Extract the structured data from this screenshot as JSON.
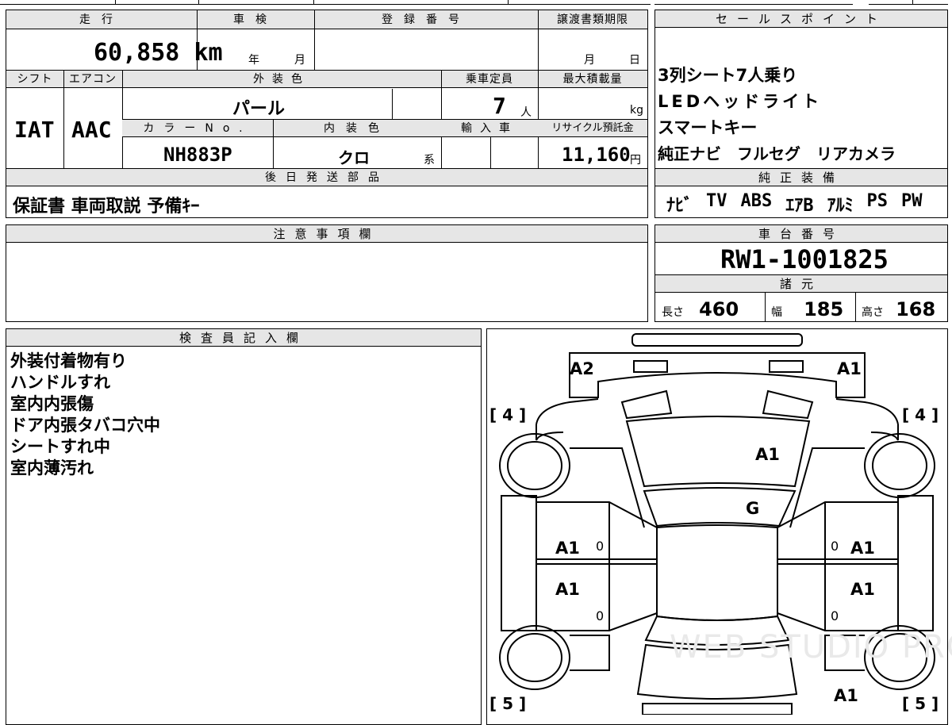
{
  "top": {
    "mileage_label": "走行",
    "mileage_value": "60,858",
    "mileage_unit": "km",
    "inspection_label": "車検",
    "inspection_year": "年",
    "inspection_month": "月",
    "registration_label": "登録番号",
    "transfer_label": "譲渡書類期限",
    "transfer_month": "月",
    "transfer_day": "日",
    "shift_label": "シフト",
    "shift_value": "IAT",
    "ac_label": "エアコン",
    "ac_value": "AAC",
    "exterior_label": "外装色",
    "exterior_value": "パール",
    "capacity_label": "乗車定員",
    "capacity_value": "7",
    "capacity_unit": "人",
    "maxload_label": "最大積載量",
    "maxload_unit": "kg",
    "colorno_label": "カラーNo.",
    "colorno_value": "NH883P",
    "interior_label": "内装色",
    "interior_value": "クロ",
    "interior_unit": "系",
    "import_label": "輸入車",
    "recycle_label": "リサイクル預託金",
    "recycle_value": "11,160",
    "recycle_unit": "円",
    "later_label": "後日発送部品",
    "later_value": "保証書 車両取説 予備ｷｰ"
  },
  "sales": {
    "label": "セールスポイント",
    "points": [
      "3列シート7人乗り",
      "LEDヘッドライト",
      "スマートキー",
      "純正ナビ　フルセグ　リアカメラ"
    ],
    "equip_label": "純正装備",
    "equip": [
      "ﾅﾋﾞ",
      "TV",
      "ABS",
      "ｴｱB",
      "ｱﾙﾐ",
      "PS",
      "PW"
    ]
  },
  "caution": {
    "label": "注意事項欄"
  },
  "chassis": {
    "label": "車台番号",
    "value": "RW1-1001825",
    "spec_label": "諸元",
    "length_label": "長さ",
    "length_value": "460",
    "width_label": "幅",
    "width_value": "185",
    "height_label": "高さ",
    "height_value": "168"
  },
  "inspector": {
    "label": "検査員記入欄",
    "notes": [
      "外装付着物有り",
      "ハンドルすれ",
      "室内内張傷",
      "ドア内張タバコ穴中",
      "シートすれ中",
      "室内薄汚れ"
    ]
  },
  "diagram": {
    "tire_fl": "[ 4 ]",
    "tire_fr": "[ 4 ]",
    "tire_rl": "[ 5 ]",
    "tire_rr": "[ 5 ]",
    "marks": {
      "front_left": "A2",
      "front_right": "A1",
      "hood": "A1",
      "windshield": "G",
      "door_fl": "A1",
      "door_fr": "A1",
      "door_rl": "A1",
      "door_rr": "A1",
      "rear_right": "A1",
      "zero_a": "0",
      "zero_b": "0",
      "zero_c": "0",
      "zero_d": "0"
    },
    "watermark": "WEB STUDIO PRO"
  }
}
